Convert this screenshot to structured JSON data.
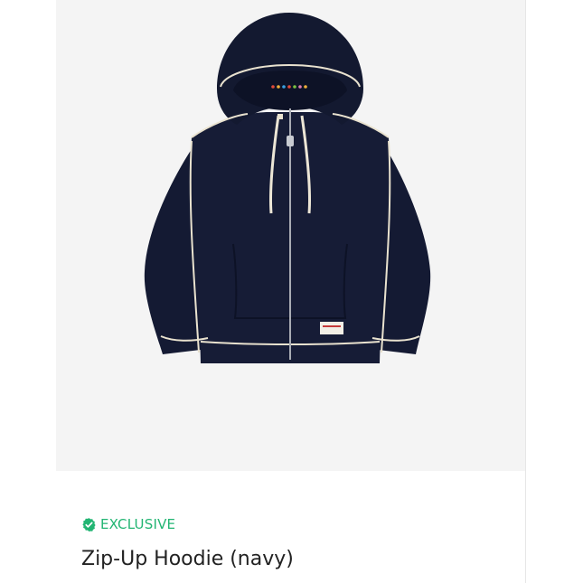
{
  "colors": {
    "accent_green": "#22b573",
    "image_background": "#f4f4f4",
    "hoodie_navy": "#141a33",
    "stitch_cream": "#e9e2cf",
    "title_text": "#222222"
  },
  "product": {
    "badge": {
      "icon": "verified-check-icon",
      "label": "EXCLUSIVE"
    },
    "title": "Zip-Up Hoodie (navy)",
    "image": {
      "subject": "navy zip-up hoodie",
      "icons": [
        "hoodie-illustration"
      ]
    }
  }
}
